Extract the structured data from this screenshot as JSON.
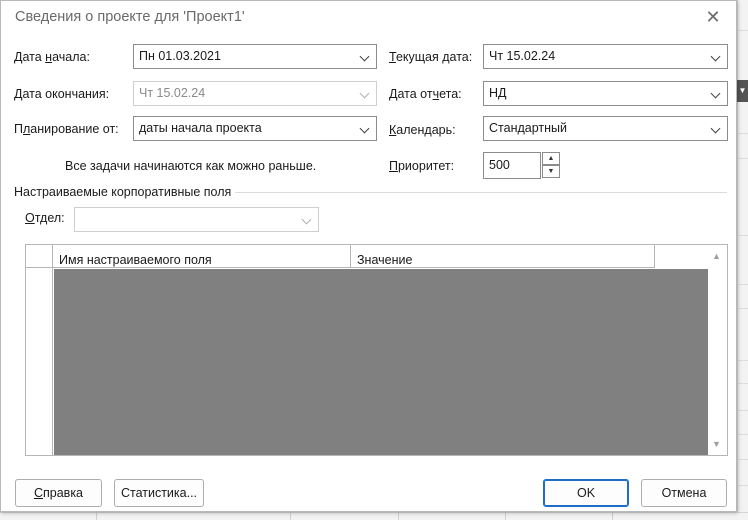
{
  "dialog": {
    "title": "Сведения о проекте для 'Проект1'",
    "close_glyph": "✕"
  },
  "fields": {
    "start_date": {
      "label_pre": "Дата ",
      "label_u": "н",
      "label_post": "ачала:",
      "value": "Пн 01.03.2021"
    },
    "finish_date": {
      "label": "Дата окончания:",
      "value": "Чт 15.02.24"
    },
    "schedule_from": {
      "label_pre": "П",
      "label_u": "л",
      "label_post": "анирование от:",
      "value": "даты начала проекта"
    },
    "schedule_note": "Все задачи начинаются как можно раньше.",
    "current_date": {
      "label_pre": "",
      "label_u": "Т",
      "label_post": "екущая дата:",
      "value": "Чт 15.02.24"
    },
    "status_date": {
      "label_pre": "Дата от",
      "label_u": "ч",
      "label_post": "ета:",
      "value": "НД"
    },
    "calendar": {
      "label_pre": "",
      "label_u": "К",
      "label_post": "алендарь:",
      "value": "Стандартный"
    },
    "priority": {
      "label_pre": "",
      "label_u": "П",
      "label_post": "риоритет:",
      "value": "500"
    }
  },
  "enterprise": {
    "section_title": "Настраиваемые корпоративные поля",
    "department": {
      "label_pre": "",
      "label_u": "О",
      "label_post": "тдел:",
      "value": ""
    },
    "columns": [
      "Имя настраиваемого поля",
      "Значение"
    ]
  },
  "buttons": {
    "help_pre": "",
    "help_u": "С",
    "help_post": "правка",
    "stats": "Статистика...",
    "ok": "OK",
    "cancel": "Отмена"
  },
  "icons": {
    "spin_up": "▲",
    "spin_down": "▼",
    "scroll_up": "▲",
    "scroll_down": "▼",
    "bg_scroll": "▼"
  }
}
